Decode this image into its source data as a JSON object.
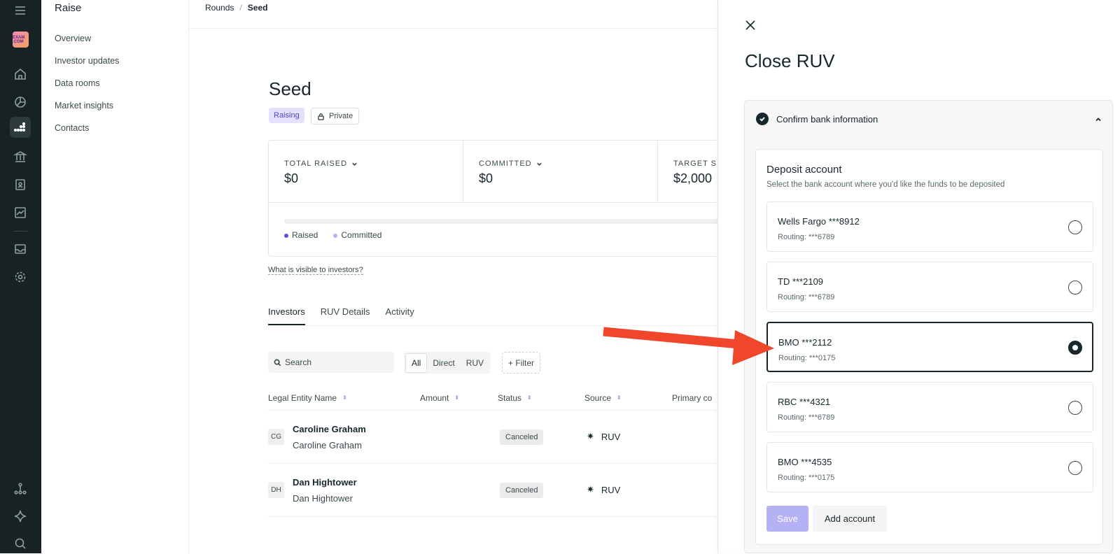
{
  "app": {
    "section_title": "Raise",
    "logo_text": "EXAM\n.COM"
  },
  "subnav": {
    "items": [
      "Overview",
      "Investor updates",
      "Data rooms",
      "Market insights",
      "Contacts"
    ]
  },
  "breadcrumb": {
    "root": "Rounds",
    "separator": "/",
    "current": "Seed"
  },
  "round": {
    "title": "Seed",
    "status_badge": "Raising",
    "visibility_badge": "Private",
    "stats": [
      {
        "label": "TOTAL RAISED",
        "value": "$0"
      },
      {
        "label": "COMMITTED",
        "value": "$0"
      },
      {
        "label": "TARGET S",
        "value": "$2,000"
      }
    ],
    "progress": {
      "raised_fraction": 0,
      "committed_fraction": 0
    },
    "legend": {
      "raised": "Raised",
      "committed": "Committed"
    },
    "visible_link": "What is visible to investors?"
  },
  "tabs": [
    "Investors",
    "RUV Details",
    "Activity"
  ],
  "filters": {
    "search_placeholder": "Search",
    "segments": [
      "All",
      "Direct",
      "RUV"
    ],
    "filter_label": "+ Filter"
  },
  "table": {
    "headers": [
      "Legal Entity Name",
      "Amount",
      "Status",
      "Source",
      "Primary co"
    ],
    "rows": [
      {
        "initials": "CG",
        "name": "Caroline Graham",
        "entity": "Caroline Graham",
        "status": "Canceled",
        "source": "RUV"
      },
      {
        "initials": "DH",
        "name": "Dan Hightower",
        "entity": "Dan Hightower",
        "status": "Canceled",
        "source": "RUV"
      }
    ]
  },
  "panel": {
    "title": "Close RUV",
    "step_title": "Confirm bank information",
    "deposit_title": "Deposit account",
    "deposit_subtitle": "Select the bank account where you'd like the funds to be deposited",
    "accounts": [
      {
        "name": "Wells Fargo ***8912",
        "routing": "Routing: ***6789",
        "selected": false
      },
      {
        "name": "TD ***2109",
        "routing": "Routing: ***6789",
        "selected": false
      },
      {
        "name": "BMO ***2112",
        "routing": "Routing: ***0175",
        "selected": true
      },
      {
        "name": "RBC ***4321",
        "routing": "Routing: ***6789",
        "selected": false
      },
      {
        "name": "BMO ***4535",
        "routing": "Routing: ***0175",
        "selected": false
      }
    ],
    "save_label": "Save",
    "add_account_label": "Add account"
  },
  "colors": {
    "sidebar_bg": "#172224",
    "accent": "#5b50e6",
    "annotation_arrow": "#f0462b"
  }
}
